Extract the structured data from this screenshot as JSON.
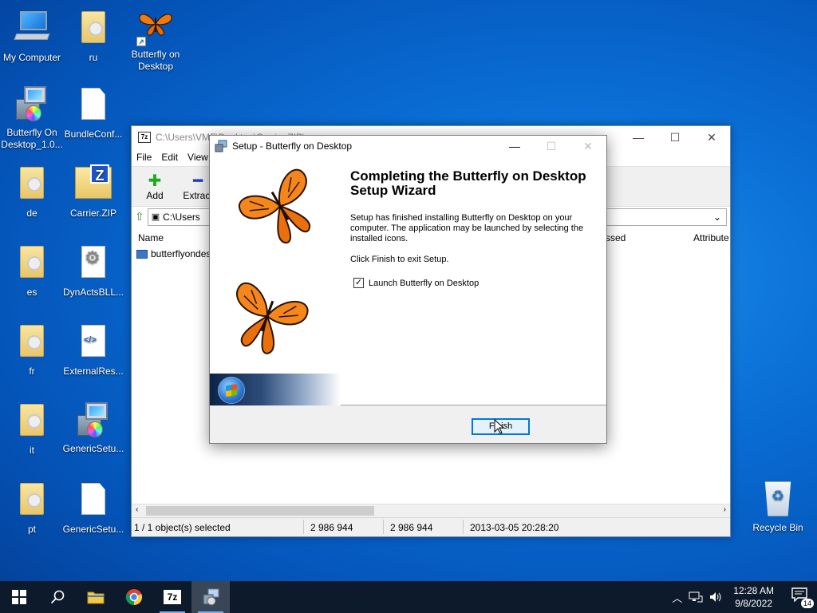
{
  "desktop": {
    "icons": [
      {
        "label": "My Computer"
      },
      {
        "label": "ru"
      },
      {
        "label": "Butterfly on Desktop"
      },
      {
        "label": "Butterfly On Desktop_1.0..."
      },
      {
        "label": "BundleConf..."
      },
      {
        "label": "de"
      },
      {
        "label": "Carrier.ZIP"
      },
      {
        "label": "es"
      },
      {
        "label": "DynActsBLL..."
      },
      {
        "label": "fr"
      },
      {
        "label": "ExternalRes..."
      },
      {
        "label": "it"
      },
      {
        "label": "GenericSetu..."
      },
      {
        "label": "pt"
      },
      {
        "label": "GenericSetu..."
      },
      {
        "label": "Recycle Bin"
      }
    ]
  },
  "zip_window": {
    "title": "C:\\Users\\VMF\\Desktop\\Carrier.ZIP\\",
    "logo": "7z",
    "menu": [
      "File",
      "Edit",
      "View"
    ],
    "toolbar": [
      {
        "label": "Add",
        "icon": "plus-icon"
      },
      {
        "label": "Extract",
        "icon": "minus-icon"
      }
    ],
    "address": "C:\\Users",
    "columns": {
      "name": "Name",
      "packed": "ssed",
      "attributes": "Attribute"
    },
    "file_row": {
      "name": "butterflyondes"
    },
    "status": {
      "selected": "1 / 1 object(s) selected",
      "size": "2 986 944",
      "packed": "2 986 944",
      "modified": "2013-03-05 20:28:20"
    }
  },
  "setup_dialog": {
    "title": "Setup - Butterfly on Desktop",
    "heading": "Completing the Butterfly on Desktop Setup Wizard",
    "body": "Setup has finished installing Butterfly on Desktop on your computer. The application may be launched by selecting the installed icons.",
    "exit_hint": "Click Finish to exit Setup.",
    "launch_checkbox": {
      "label": "Launch Butterfly on Desktop",
      "checked": true
    },
    "finish_button": "Finish"
  },
  "taskbar": {
    "clock_time": "12:28 AM",
    "clock_date": "9/8/2022",
    "notification_count": "14"
  }
}
